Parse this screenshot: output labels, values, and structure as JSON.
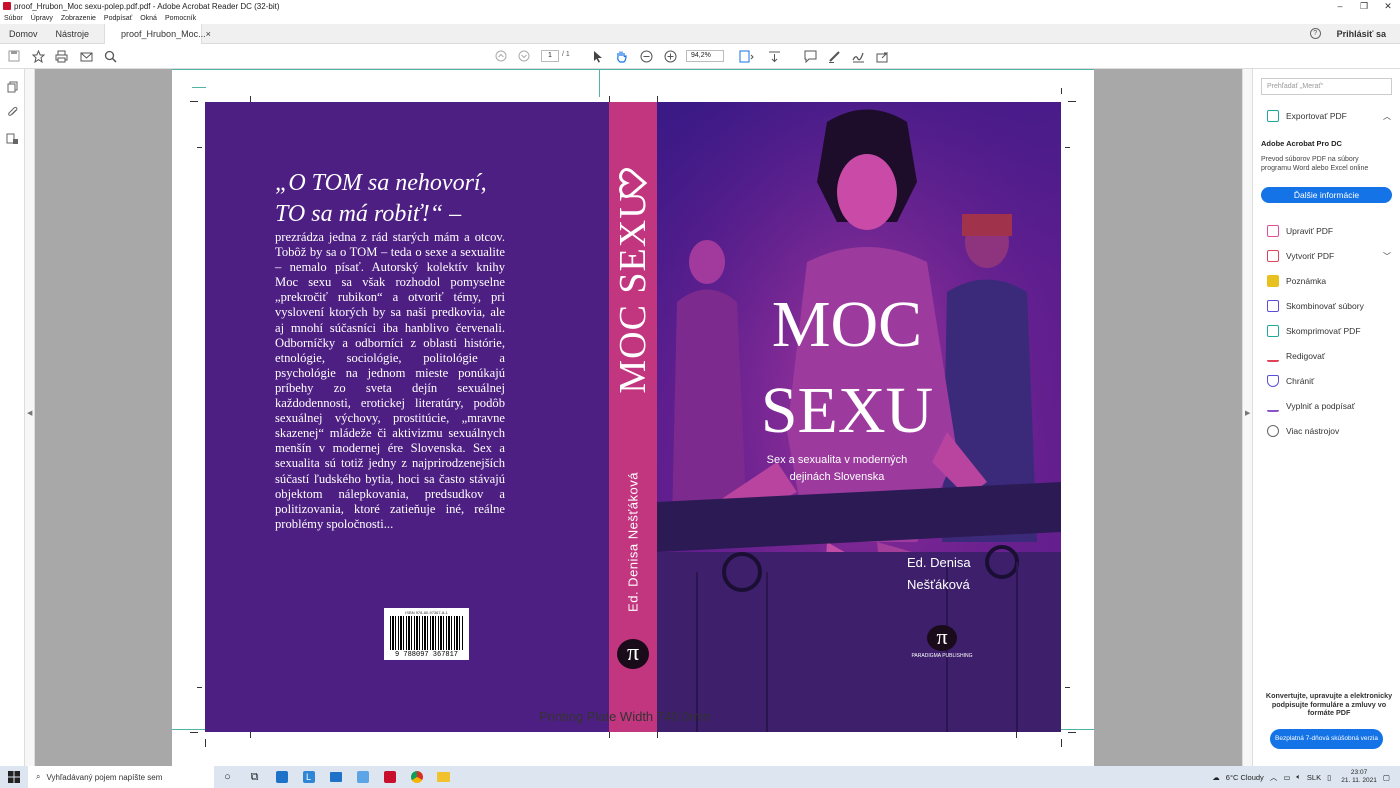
{
  "window": {
    "title": "proof_Hrubon_Moc sexu-polep.pdf.pdf - Adobe Acrobat Reader DC (32-bit)",
    "controls": [
      "–",
      "❐",
      "✕"
    ]
  },
  "menu": [
    "Súbor",
    "Úpravy",
    "Zobrazenie",
    "Podpísať",
    "Okná",
    "Pomocník"
  ],
  "tabs": {
    "home": "Domov",
    "tools": "Nástroje",
    "document": "proof_Hrubon_Moc...",
    "close": "×",
    "help": "?",
    "signin": "Prihlásiť sa"
  },
  "toolbar": {
    "page_current": "1",
    "page_total": "/ 1",
    "zoom": "94,2%"
  },
  "cover": {
    "back_heading": "„O TOM sa nehovorí, TO sa má robiť!“ –",
    "back_text": "prezrádza jedna z rád starých mám a otcov. Tobôž by sa o TOM – teda o sexe a sexualite – nemalo písať. Autorský kolektív knihy Moc sexu sa však rozhodol pomyselne „prekročiť rubikon“ a otvoriť témy, pri vyslovení ktorých by sa naši predkovia, ale aj mnohí súčasníci iba hanblivo červenali. Odborníčky a odborníci z oblasti histórie, etnológie, sociológie, politológie a psychológie na jednom mieste ponúkajú príbehy zo sveta dejín sexuálnej každodennosti, erotickej literatúry, podôb sexuálnej výchovy, prostitúcie, „mravne skazenej“ mládeže či aktivizmu sexuálnych menšín v modernej ére Slovenska. Sex a sexualita sú totiž jedny z najprirodzenejších súčastí ľudského bytia, hoci sa často stávajú objektom nálepkovania, predsudkov a politizovania, ktoré zatieňuje iné, reálne problémy spoločnosti...",
    "isbn_line": "ISBN 978-80-97367-8-1",
    "barcode_number": "9 788097 367817",
    "spine_title": "MOC SEXU",
    "spine_author": "Ed. Denisa Nešťáková",
    "pi": "π",
    "front_title_1": "MOC",
    "front_title_2": "SEXU",
    "front_subtitle_1": "Sex a sexualita v moderných",
    "front_subtitle_2": "dejinách Slovenska",
    "front_editor_1": "Ed. Denisa",
    "front_editor_2": "Nešťáková",
    "publisher": "PARADIGMA    PUBLISHING",
    "plate_width": "Printing Plate Width 740.0mm",
    "colors": {
      "back": "#4e1f83",
      "spine": "#c2357f",
      "front": "#5a1d8e"
    }
  },
  "panel": {
    "search_placeholder": "Prehľadať „Merať“",
    "export": "Exportovať PDF",
    "promo_title": "Adobe Acrobat Pro DC",
    "promo_text": "Prevod súborov PDF na súbory programu Word alebo Excel online",
    "promo_button": "Ďalšie informácie",
    "tools": [
      {
        "label": "Upraviť PDF",
        "color": "#e04e9b"
      },
      {
        "label": "Vytvoriť PDF",
        "color": "#e0445b"
      },
      {
        "label": "Poznámka",
        "color": "#e8c11e"
      },
      {
        "label": "Skombinovať súbory",
        "color": "#5b4fd6"
      },
      {
        "label": "Skomprimovať PDF",
        "color": "#1ea99a"
      },
      {
        "label": "Redigovať",
        "color": "#e0445b"
      },
      {
        "label": "Chrániť",
        "color": "#5b4fd6"
      },
      {
        "label": "Vyplniť a podpísať",
        "color": "#8a54c7"
      },
      {
        "label": "Viac nástrojov",
        "color": "#666666"
      }
    ],
    "bottom_text": "Konvertujte, upravujte a elektronicky podpisujte formuláre a zmluvy vo formáte PDF",
    "trial_button": "Bezplatná 7-dňová skúšobná verzia"
  },
  "taskbar": {
    "search": "Vyhľadávaný pojem napíšte sem",
    "weather": "6°C  Cloudy",
    "lang": "SLK",
    "time": "23:07",
    "date": "21. 11. 2021"
  }
}
